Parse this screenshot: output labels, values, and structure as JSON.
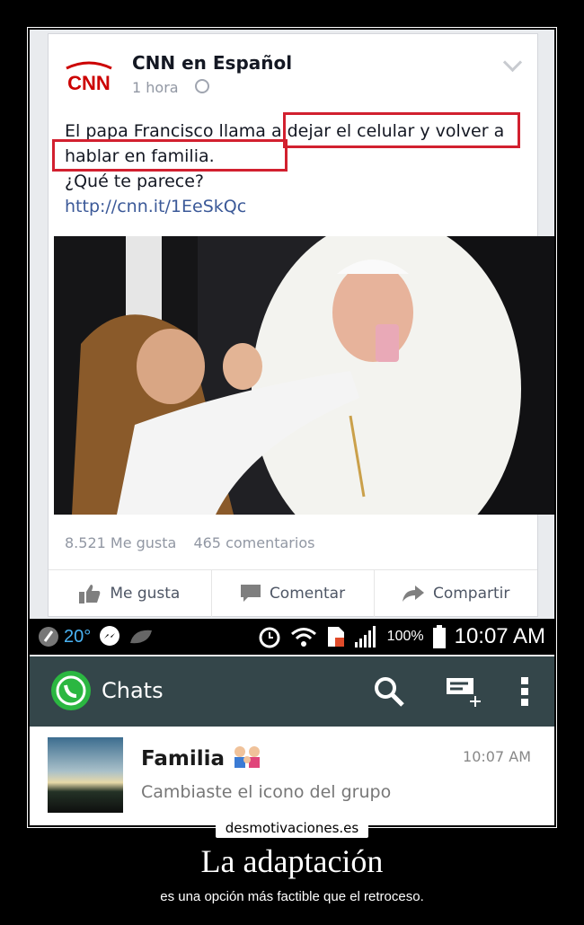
{
  "post": {
    "page_name": "CNN en Español",
    "time": "1 hora",
    "text_line1": "El papa Francisco llama a dejar el celular y volver a",
    "text_line2": "hablar en familia.",
    "text_line3": "¿Qué te parece?",
    "link": "http://cnn.it/1EeSkQc",
    "likes": "8.521 Me gusta",
    "comments": "465 comentarios",
    "actions": [
      "Me gusta",
      "Comentar",
      "Compartir"
    ],
    "logo_text": "CNN"
  },
  "statusbar": {
    "temperature": "20°",
    "battery": "100%",
    "clock": "10:07 AM"
  },
  "whatsapp": {
    "title": "Chats",
    "chat": {
      "name": "Familia",
      "time": "10:07 AM",
      "message": "Cambiaste el icono del grupo"
    }
  },
  "caption": {
    "site": "desmotivaciones.es",
    "title": "La adaptación",
    "subtitle": "es una opción más factible que el retroceso."
  },
  "colors": {
    "highlight": "#d2202f",
    "whatsapp_bar": "#34464a",
    "link": "#3b5998"
  }
}
